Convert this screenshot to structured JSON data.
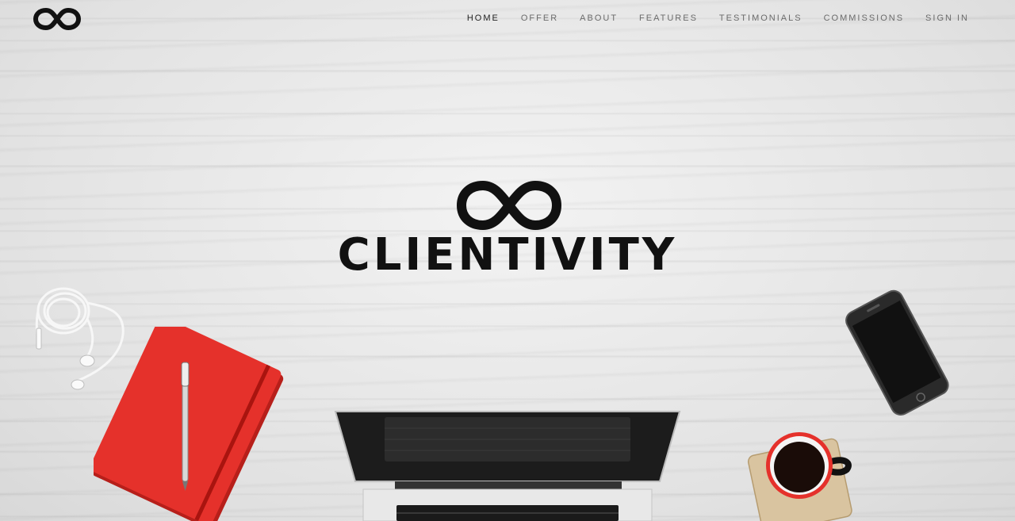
{
  "brand": {
    "name": "CLIENTIVITY"
  },
  "nav": {
    "items": [
      {
        "label": "HOME",
        "active": true
      },
      {
        "label": "OFFER",
        "active": false
      },
      {
        "label": "ABOUT",
        "active": false
      },
      {
        "label": "FEATURES",
        "active": false
      },
      {
        "label": "TESTIMONIALS",
        "active": false
      },
      {
        "label": "COMMISSIONS",
        "active": false
      },
      {
        "label": "SIGN IN",
        "active": false
      }
    ]
  },
  "colors": {
    "nav_text": "#6b6b6b",
    "nav_active": "#222222",
    "brand": "#111111",
    "notebook": "#e5312b",
    "background": "#e4e4e4"
  },
  "icons": {
    "logo": "infinity-logo-icon"
  }
}
